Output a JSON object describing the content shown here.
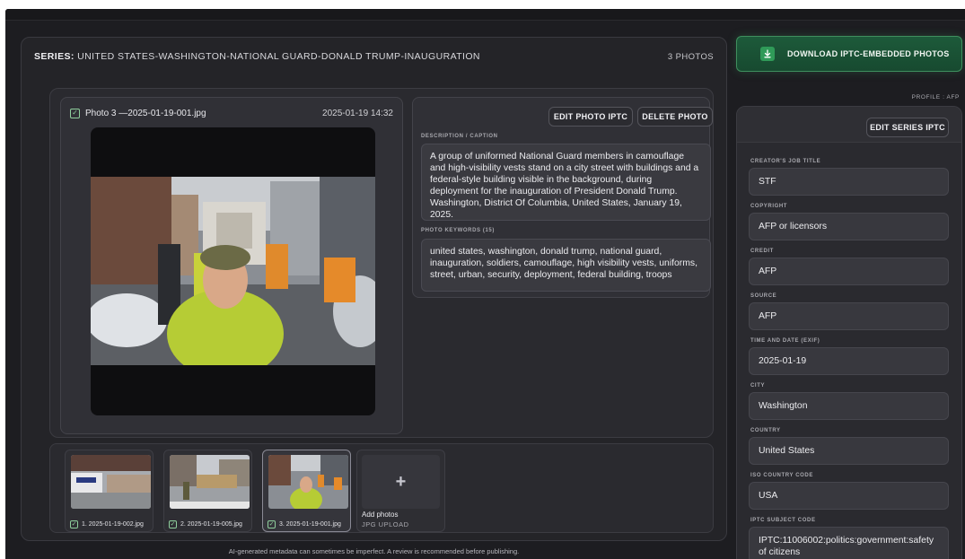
{
  "series": {
    "prefix": "SERIES:",
    "name": "UNITED STATES-WASHINGTON-NATIONAL GUARD-DONALD TRUMP-INAUGURATION",
    "count_label": "3 PHOTOS"
  },
  "photo": {
    "filename": "Photo 3 —2025-01-19-001.jpg",
    "datetime": "2025-01-19 14:32",
    "checked": "✓"
  },
  "actions": {
    "edit_photo": "EDIT PHOTO IPTC",
    "delete_photo": "DELETE PHOTO"
  },
  "description": {
    "label": "DESCRIPTION / CAPTION",
    "text": "A group of uniformed National Guard members in camouflage and high-visibility vests stand on a city street with buildings and a federal-style building visible in the background, during deployment for the inauguration of President Donald Trump. Washington, District Of Columbia, United States, January 19, 2025."
  },
  "keywords": {
    "label": "PHOTO KEYWORDS (15)",
    "text": "united states, washington, donald trump, national guard, inauguration, soldiers, camouflage, high visibility vests, uniforms, street, urban, security, deployment, federal building, troops"
  },
  "thumbnails": [
    {
      "label": "1. 2025-01-19-002.jpg",
      "active": false
    },
    {
      "label": "2. 2025-01-19-005.jpg",
      "active": false
    },
    {
      "label": "3. 2025-01-19-001.jpg",
      "active": true
    }
  ],
  "add_photos": {
    "label": "Add photos",
    "sub": "JPG UPLOAD",
    "icon": "+"
  },
  "disclaimer": "AI-generated metadata can sometimes be imperfect. A review is recommended before publishing.",
  "download": {
    "label": "DOWNLOAD IPTC-EMBEDDED PHOTOS"
  },
  "profile": "PROFILE : AFP",
  "series_iptc": {
    "edit_label": "EDIT SERIES IPTC",
    "fields": [
      {
        "label": "CREATOR'S JOB TITLE",
        "value": "STF"
      },
      {
        "label": "COPYRIGHT",
        "value": "AFP or licensors"
      },
      {
        "label": "CREDIT",
        "value": "AFP"
      },
      {
        "label": "SOURCE",
        "value": "AFP"
      },
      {
        "label": "TIME AND DATE (EXIF)",
        "value": "2025-01-19"
      },
      {
        "label": "CITY",
        "value": "Washington"
      },
      {
        "label": "COUNTRY",
        "value": "United States"
      },
      {
        "label": "ISO COUNTRY CODE",
        "value": "USA"
      },
      {
        "label": "IPTC SUBJECT CODE",
        "value": "IPTC:11006002:politics:government:safety of citizens"
      }
    ]
  },
  "colors": {
    "background": "#1d1d21",
    "panel": "#242428",
    "accent_green": "#2f9a58",
    "check_green": "#8fcf9d"
  }
}
